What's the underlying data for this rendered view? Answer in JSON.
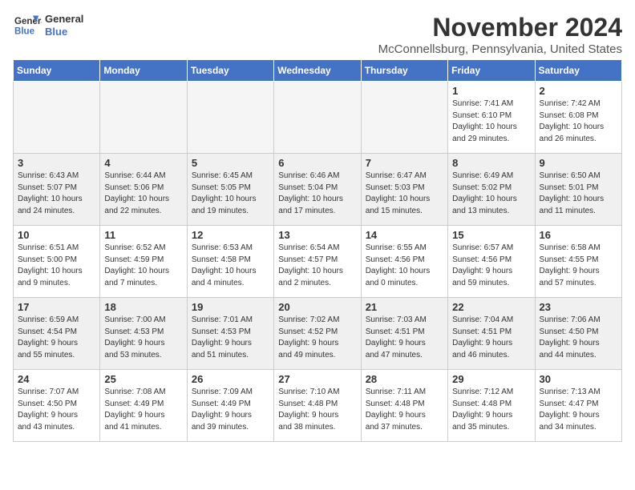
{
  "header": {
    "logo_line1": "General",
    "logo_line2": "Blue",
    "month": "November 2024",
    "location": "McConnellsburg, Pennsylvania, United States"
  },
  "weekdays": [
    "Sunday",
    "Monday",
    "Tuesday",
    "Wednesday",
    "Thursday",
    "Friday",
    "Saturday"
  ],
  "weeks": [
    [
      {
        "day": "",
        "info": ""
      },
      {
        "day": "",
        "info": ""
      },
      {
        "day": "",
        "info": ""
      },
      {
        "day": "",
        "info": ""
      },
      {
        "day": "",
        "info": ""
      },
      {
        "day": "1",
        "info": "Sunrise: 7:41 AM\nSunset: 6:10 PM\nDaylight: 10 hours\nand 29 minutes."
      },
      {
        "day": "2",
        "info": "Sunrise: 7:42 AM\nSunset: 6:08 PM\nDaylight: 10 hours\nand 26 minutes."
      }
    ],
    [
      {
        "day": "3",
        "info": "Sunrise: 6:43 AM\nSunset: 5:07 PM\nDaylight: 10 hours\nand 24 minutes."
      },
      {
        "day": "4",
        "info": "Sunrise: 6:44 AM\nSunset: 5:06 PM\nDaylight: 10 hours\nand 22 minutes."
      },
      {
        "day": "5",
        "info": "Sunrise: 6:45 AM\nSunset: 5:05 PM\nDaylight: 10 hours\nand 19 minutes."
      },
      {
        "day": "6",
        "info": "Sunrise: 6:46 AM\nSunset: 5:04 PM\nDaylight: 10 hours\nand 17 minutes."
      },
      {
        "day": "7",
        "info": "Sunrise: 6:47 AM\nSunset: 5:03 PM\nDaylight: 10 hours\nand 15 minutes."
      },
      {
        "day": "8",
        "info": "Sunrise: 6:49 AM\nSunset: 5:02 PM\nDaylight: 10 hours\nand 13 minutes."
      },
      {
        "day": "9",
        "info": "Sunrise: 6:50 AM\nSunset: 5:01 PM\nDaylight: 10 hours\nand 11 minutes."
      }
    ],
    [
      {
        "day": "10",
        "info": "Sunrise: 6:51 AM\nSunset: 5:00 PM\nDaylight: 10 hours\nand 9 minutes."
      },
      {
        "day": "11",
        "info": "Sunrise: 6:52 AM\nSunset: 4:59 PM\nDaylight: 10 hours\nand 7 minutes."
      },
      {
        "day": "12",
        "info": "Sunrise: 6:53 AM\nSunset: 4:58 PM\nDaylight: 10 hours\nand 4 minutes."
      },
      {
        "day": "13",
        "info": "Sunrise: 6:54 AM\nSunset: 4:57 PM\nDaylight: 10 hours\nand 2 minutes."
      },
      {
        "day": "14",
        "info": "Sunrise: 6:55 AM\nSunset: 4:56 PM\nDaylight: 10 hours\nand 0 minutes."
      },
      {
        "day": "15",
        "info": "Sunrise: 6:57 AM\nSunset: 4:56 PM\nDaylight: 9 hours\nand 59 minutes."
      },
      {
        "day": "16",
        "info": "Sunrise: 6:58 AM\nSunset: 4:55 PM\nDaylight: 9 hours\nand 57 minutes."
      }
    ],
    [
      {
        "day": "17",
        "info": "Sunrise: 6:59 AM\nSunset: 4:54 PM\nDaylight: 9 hours\nand 55 minutes."
      },
      {
        "day": "18",
        "info": "Sunrise: 7:00 AM\nSunset: 4:53 PM\nDaylight: 9 hours\nand 53 minutes."
      },
      {
        "day": "19",
        "info": "Sunrise: 7:01 AM\nSunset: 4:53 PM\nDaylight: 9 hours\nand 51 minutes."
      },
      {
        "day": "20",
        "info": "Sunrise: 7:02 AM\nSunset: 4:52 PM\nDaylight: 9 hours\nand 49 minutes."
      },
      {
        "day": "21",
        "info": "Sunrise: 7:03 AM\nSunset: 4:51 PM\nDaylight: 9 hours\nand 47 minutes."
      },
      {
        "day": "22",
        "info": "Sunrise: 7:04 AM\nSunset: 4:51 PM\nDaylight: 9 hours\nand 46 minutes."
      },
      {
        "day": "23",
        "info": "Sunrise: 7:06 AM\nSunset: 4:50 PM\nDaylight: 9 hours\nand 44 minutes."
      }
    ],
    [
      {
        "day": "24",
        "info": "Sunrise: 7:07 AM\nSunset: 4:50 PM\nDaylight: 9 hours\nand 43 minutes."
      },
      {
        "day": "25",
        "info": "Sunrise: 7:08 AM\nSunset: 4:49 PM\nDaylight: 9 hours\nand 41 minutes."
      },
      {
        "day": "26",
        "info": "Sunrise: 7:09 AM\nSunset: 4:49 PM\nDaylight: 9 hours\nand 39 minutes."
      },
      {
        "day": "27",
        "info": "Sunrise: 7:10 AM\nSunset: 4:48 PM\nDaylight: 9 hours\nand 38 minutes."
      },
      {
        "day": "28",
        "info": "Sunrise: 7:11 AM\nSunset: 4:48 PM\nDaylight: 9 hours\nand 37 minutes."
      },
      {
        "day": "29",
        "info": "Sunrise: 7:12 AM\nSunset: 4:48 PM\nDaylight: 9 hours\nand 35 minutes."
      },
      {
        "day": "30",
        "info": "Sunrise: 7:13 AM\nSunset: 4:47 PM\nDaylight: 9 hours\nand 34 minutes."
      }
    ]
  ],
  "colors": {
    "header_bg": "#4472C4",
    "shaded_row": "#f0f0f0"
  }
}
